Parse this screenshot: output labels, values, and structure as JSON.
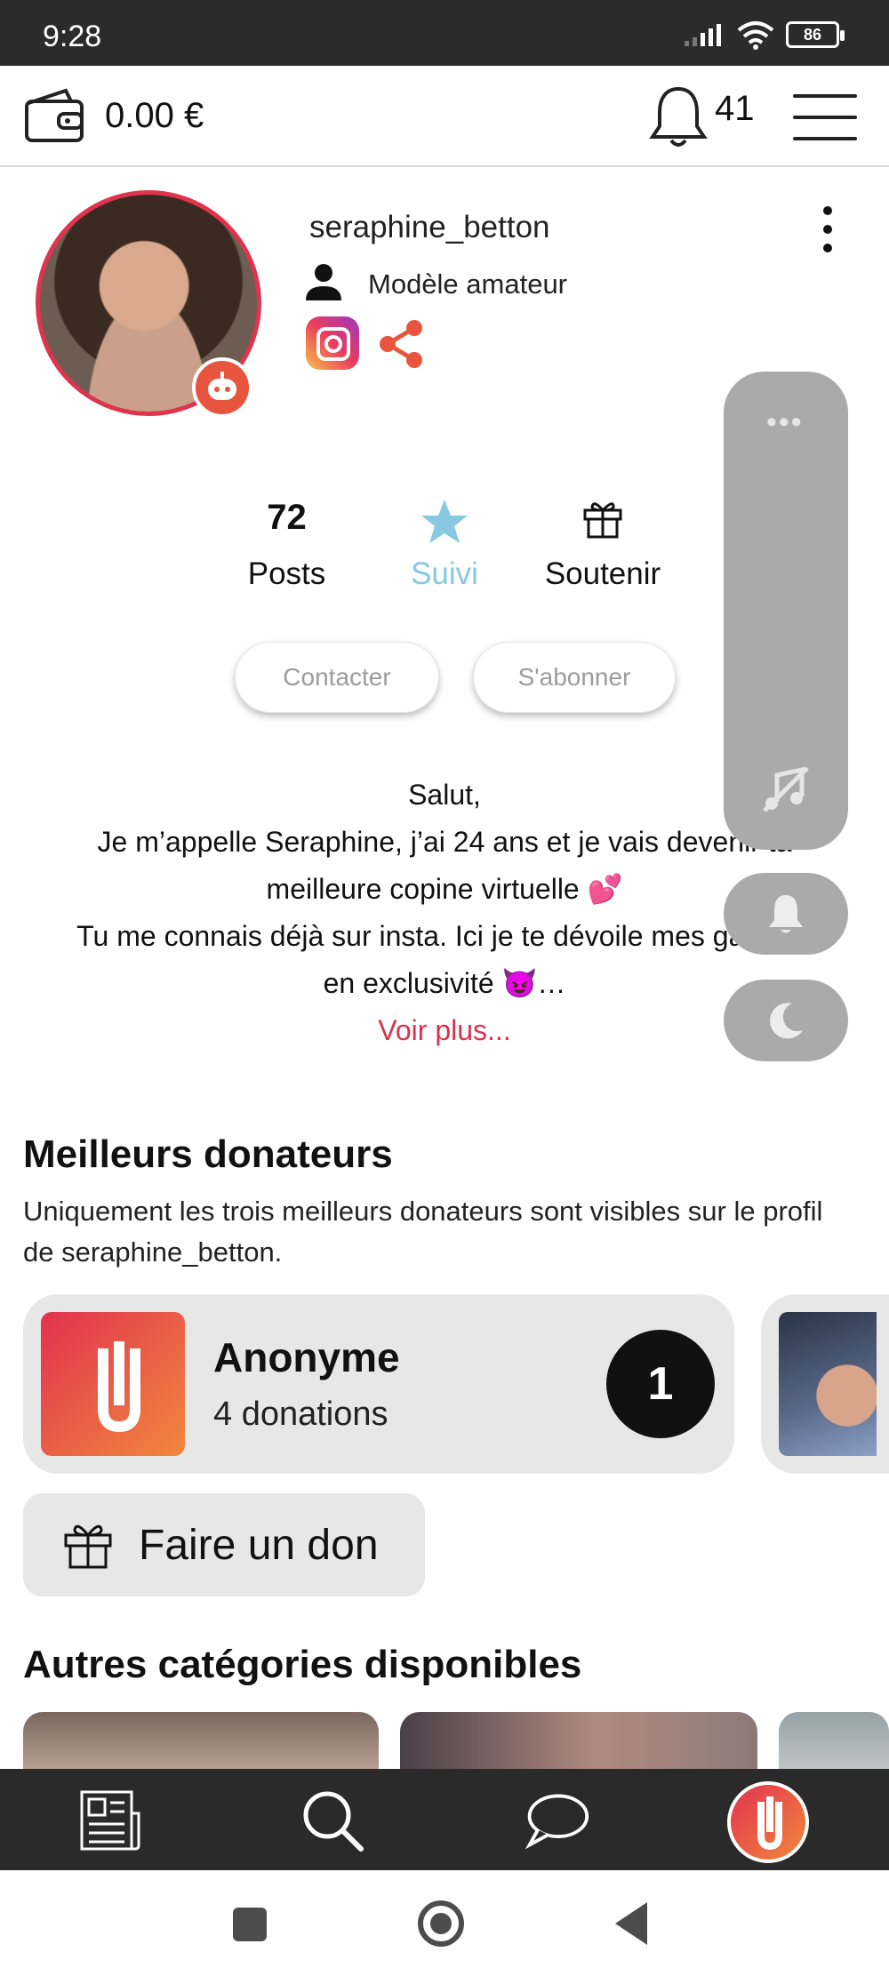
{
  "status_bar": {
    "time": "9:28",
    "battery": "86"
  },
  "header": {
    "balance": "0.00 €",
    "notification_count": "41"
  },
  "profile": {
    "username": "seraphine_betton",
    "role": "Modèle amateur",
    "stats": {
      "posts_count": "72",
      "posts_label": "Posts",
      "follow_label": "Suivi",
      "support_label": "Soutenir"
    },
    "actions": {
      "contact": "Contacter",
      "subscribe": "S'abonner"
    },
    "bio_lines": [
      "Salut,",
      "Je m’appelle Seraphine, j’ai 24 ans et je vais devenir ta",
      "meilleure copine virtuelle 💕",
      "Tu me connais déjà sur insta. Ici je te dévoile mes galeries",
      "en exclusivité 😈…"
    ],
    "see_more": "Voir plus..."
  },
  "side_panel": {
    "dots": "•••"
  },
  "donors": {
    "title": "Meilleurs donateurs",
    "subtitle": "Uniquement les trois meilleurs donateurs sont visibles sur le profil de seraphine_betton.",
    "items": [
      {
        "name": "Anonyme",
        "donations": "4 donations",
        "rank": "1"
      }
    ],
    "donate_button": "Faire un don"
  },
  "categories": {
    "title": "Autres catégories disponibles"
  },
  "colors": {
    "accent": "#e0344e",
    "follow": "#88c8e0",
    "panel": "#aaaaaa",
    "nav": "#2a2a2a"
  },
  "icons": {
    "wallet": "wallet-icon",
    "bell": "bell-icon",
    "menu": "hamburger-icon",
    "role": "person-icon",
    "instagram": "instagram-icon",
    "share": "share-icon",
    "star": "star-icon",
    "gift": "gift-icon",
    "music_off": "music-off-icon",
    "moon": "moon-icon"
  }
}
